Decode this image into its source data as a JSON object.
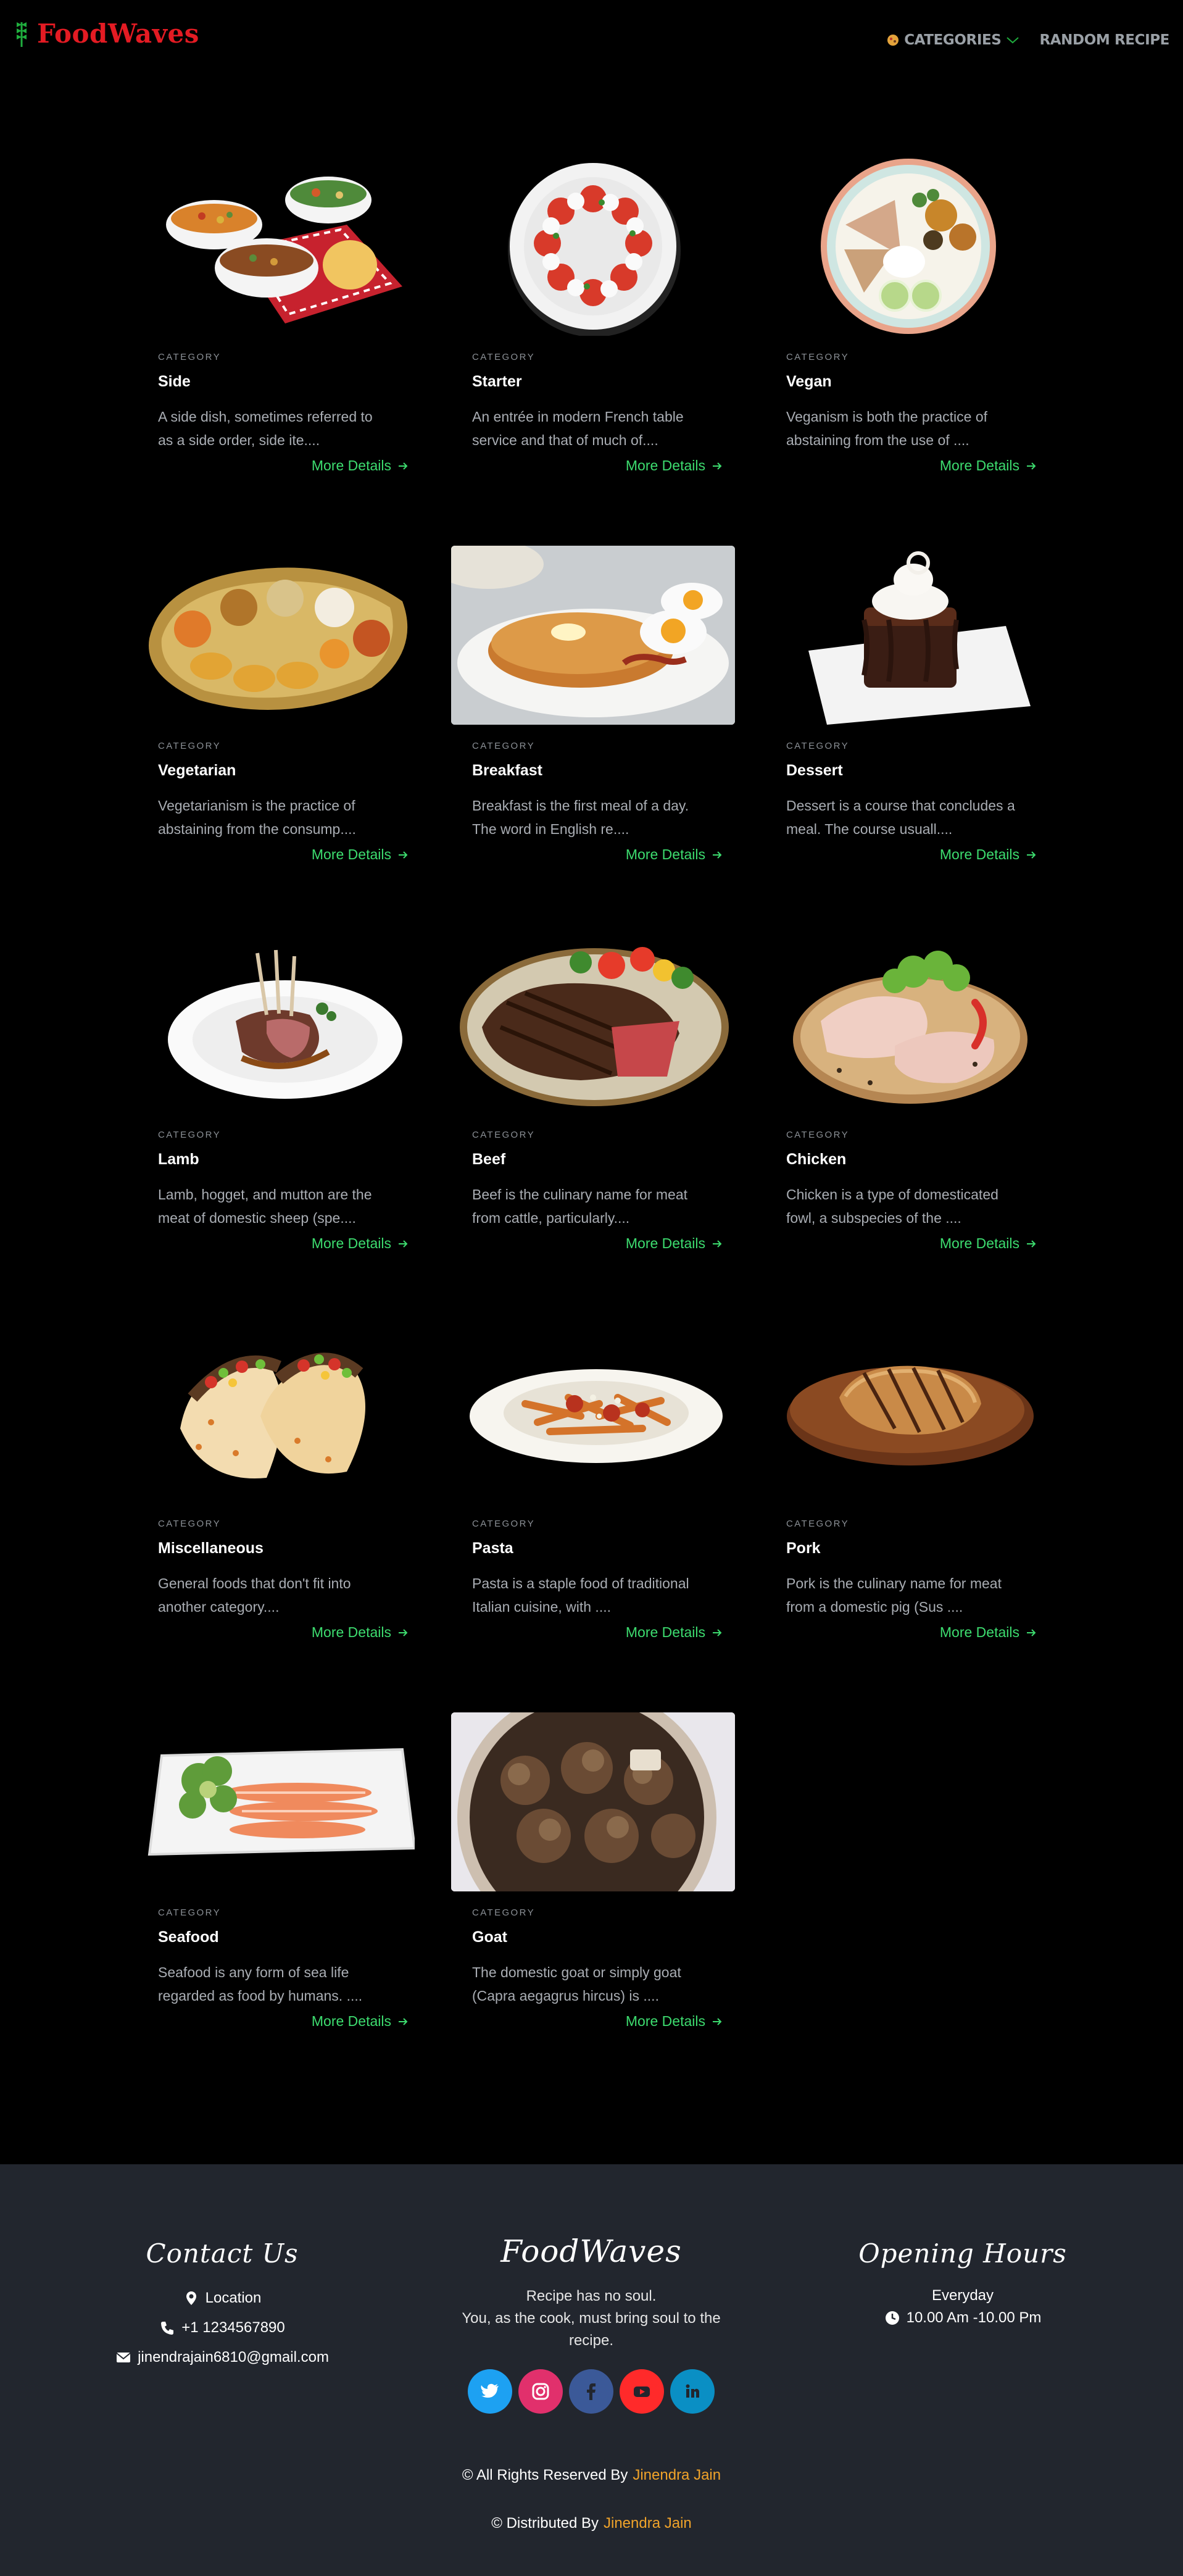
{
  "header": {
    "logo_text": "FoodWaves",
    "nav": {
      "categories_label": "CATEGORIES",
      "random_label": "RANDOM RECIPE"
    }
  },
  "cards": [
    {
      "category_label": "CATEGORY",
      "title": "Side",
      "desc_1": "A side dish, sometimes referred to",
      "desc_2": "as a side order, side ite....",
      "more": "More Details"
    },
    {
      "category_label": "CATEGORY",
      "title": "Starter",
      "desc_1": "An entrée in modern French table",
      "desc_2": "service and that of much of....",
      "more": "More Details"
    },
    {
      "category_label": "CATEGORY",
      "title": "Vegan",
      "desc_1": "Veganism is both the practice of",
      "desc_2": "abstaining from the use of ....",
      "more": "More Details"
    },
    {
      "category_label": "CATEGORY",
      "title": "Vegetarian",
      "desc_1": "Vegetarianism is the practice of",
      "desc_2": "abstaining from the consump....",
      "more": "More Details"
    },
    {
      "category_label": "CATEGORY",
      "title": "Breakfast",
      "desc_1": "Breakfast is the first meal of a day.",
      "desc_2": "The word in English re....",
      "more": "More Details"
    },
    {
      "category_label": "CATEGORY",
      "title": "Dessert",
      "desc_1": "Dessert is a course that concludes a",
      "desc_2": "meal. The course usuall....",
      "more": "More Details"
    },
    {
      "category_label": "CATEGORY",
      "title": "Lamb",
      "desc_1": "Lamb, hogget, and mutton are the",
      "desc_2": "meat of domestic sheep (spe....",
      "more": "More Details"
    },
    {
      "category_label": "CATEGORY",
      "title": "Beef",
      "desc_1": "Beef is the culinary name for meat",
      "desc_2": "from cattle, particularly....",
      "more": "More Details"
    },
    {
      "category_label": "CATEGORY",
      "title": "Chicken",
      "desc_1": "Chicken is a type of domesticated",
      "desc_2": "fowl, a subspecies of the ....",
      "more": "More Details"
    },
    {
      "category_label": "CATEGORY",
      "title": "Miscellaneous",
      "desc_1": "General foods that don't fit into",
      "desc_2": "another category....",
      "more": "More Details"
    },
    {
      "category_label": "CATEGORY",
      "title": "Pasta",
      "desc_1": "Pasta is a staple food of traditional",
      "desc_2": "Italian cuisine, with ....",
      "more": "More Details"
    },
    {
      "category_label": "CATEGORY",
      "title": "Pork",
      "desc_1": "Pork is the culinary name for meat",
      "desc_2": "from a domestic pig (Sus ....",
      "more": "More Details"
    },
    {
      "category_label": "CATEGORY",
      "title": "Seafood",
      "desc_1": "Seafood is any form of sea life",
      "desc_2": "regarded as food by humans. ....",
      "more": "More Details"
    },
    {
      "category_label": "CATEGORY",
      "title": "Goat",
      "desc_1": "The domestic goat or simply goat",
      "desc_2": "(Capra aegagrus hircus) is ....",
      "more": "More Details"
    }
  ],
  "footer": {
    "contact": {
      "heading": "Contact Us",
      "location": "Location",
      "phone": "+1 1234567890",
      "email": "jinendrajain6810@gmail.com"
    },
    "brand": {
      "heading": "FoodWaves",
      "tagline_1": "Recipe has no soul.",
      "tagline_2": "You, as the cook, must bring soul to the",
      "tagline_3": "recipe."
    },
    "hours": {
      "heading": "Opening Hours",
      "days": "Everyday",
      "time": "10.00 Am -10.00 Pm"
    },
    "rights_text": "© All Rights Reserved By",
    "rights_name": "Jinendra Jain",
    "distributed_text": "© Distributed By",
    "distributed_name": "Jinendra Jain"
  },
  "colors": {
    "accent_green": "#3ddc6f",
    "logo_red": "#e31b23",
    "credit_orange": "#f0a32a",
    "footer_bg": "#22262e",
    "twitter": "#1da1f2",
    "instagram": "#e1306c",
    "facebook": "#3b5998",
    "youtube": "#ff2a2a",
    "linkedin": "#0a8fc4"
  }
}
